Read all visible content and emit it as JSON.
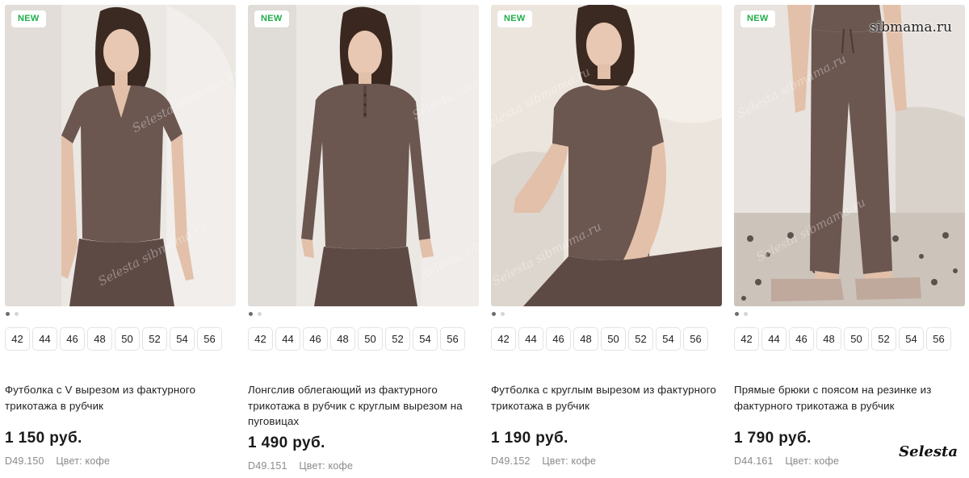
{
  "products": [
    {
      "badge": "NEW",
      "sizes": [
        "42",
        "44",
        "46",
        "48",
        "50",
        "52",
        "54",
        "56"
      ],
      "title": "Футболка с V вырезом из фактурного трикотажа в рубчик",
      "price": "1 150 руб.",
      "sku": "D49.150",
      "color": "Цвет: кофе",
      "image_icon": "product-photo-vneck-tee"
    },
    {
      "badge": "NEW",
      "sizes": [
        "42",
        "44",
        "46",
        "48",
        "50",
        "52",
        "54",
        "56"
      ],
      "title": "Лонгслив облегающий из фактурного трикотажа в рубчик с круглым вырезом на пуговицах",
      "price": "1 490 руб.",
      "sku": "D49.151",
      "color": "Цвет: кофе",
      "image_icon": "product-photo-henley-longsleeve"
    },
    {
      "badge": "NEW",
      "sizes": [
        "42",
        "44",
        "46",
        "48",
        "50",
        "52",
        "54",
        "56"
      ],
      "title": "Футболка с круглым вырезом из фактурного трикотажа в рубчик",
      "price": "1 190 руб.",
      "sku": "D49.152",
      "color": "Цвет: кофе",
      "image_icon": "product-photo-crewneck-tee"
    },
    {
      "badge": "NEW",
      "sizes": [
        "42",
        "44",
        "46",
        "48",
        "50",
        "52",
        "54",
        "56"
      ],
      "title": "Прямые брюки с поясом на резинке из фактурного трикотажа в рубчик",
      "price": "1 790 руб.",
      "sku": "D44.161",
      "color": "Цвет: кофе",
      "image_icon": "product-photo-straight-pants"
    }
  ],
  "watermarks": {
    "site": "sibmama.ru",
    "brand": "Selesta",
    "overlay": "Selesta sibmama.ru"
  },
  "colors": {
    "badge_text": "#1fae4a",
    "garment": "#6b5650",
    "price": "#1a1a1a",
    "meta": "#8a8a8a"
  }
}
